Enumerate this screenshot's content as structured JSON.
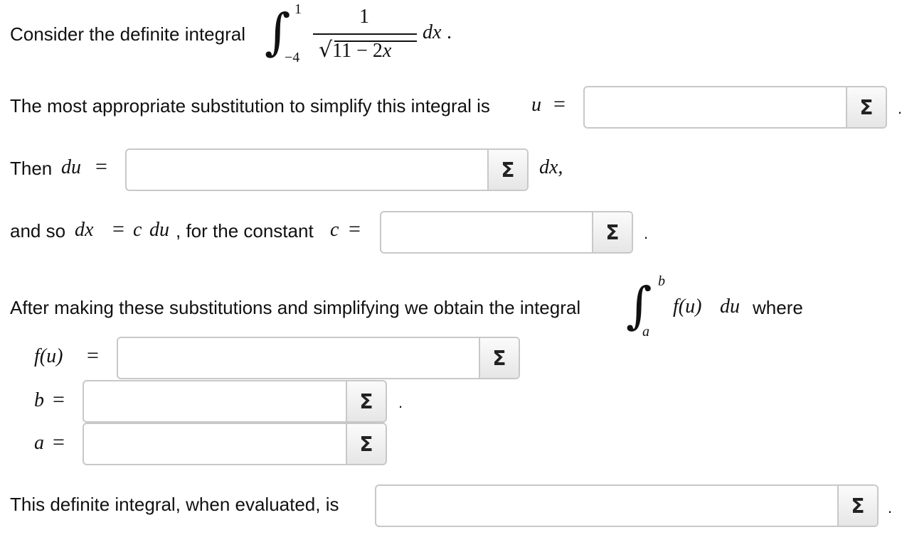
{
  "intro": {
    "text": "Consider the definite integral",
    "integral": {
      "upper": "1",
      "lower": "−4",
      "numerator": "1",
      "radicand": "11 − 2",
      "radicand_var": "x",
      "differential": "dx",
      "end_punct": "."
    }
  },
  "q1": {
    "text": "The most appropriate substitution to simplify this integral is",
    "var": "u",
    "eq": "=",
    "end": "."
  },
  "q2": {
    "text": "Then",
    "var": "du",
    "eq": "=",
    "after": "dx,",
    "end": ""
  },
  "q3": {
    "text1": "and so",
    "expr_dx": "dx",
    "eq1": "=",
    "expr_c": "c",
    "expr_du": "du",
    "text2": ", for the constant",
    "var_c": "c",
    "eq2": "=",
    "end": "."
  },
  "q4": {
    "text": "After making these substitutions and simplifying we obtain the integral",
    "upper": "b",
    "lower": "a",
    "integrand": "f(u)",
    "differential": "du",
    "after": "where"
  },
  "fu_row": {
    "label": "f(u)",
    "eq": "="
  },
  "b_row": {
    "label": "b",
    "eq": "=",
    "end": "."
  },
  "a_row": {
    "label": "a",
    "eq": "="
  },
  "final": {
    "text": "This definite integral, when evaluated, is",
    "end": "."
  },
  "sigma_label": "Σ"
}
